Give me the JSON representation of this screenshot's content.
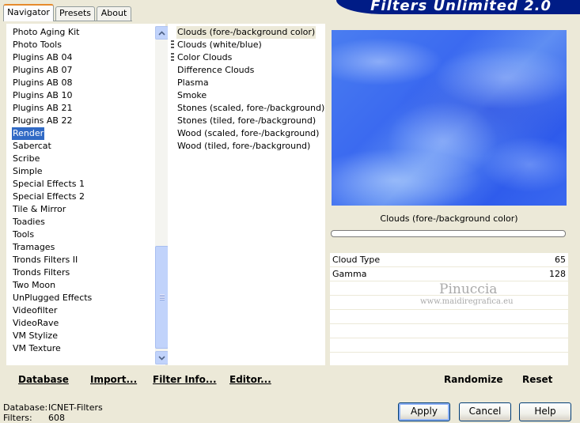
{
  "tabs": [
    {
      "label": "Navigator"
    },
    {
      "label": "Presets"
    },
    {
      "label": "About"
    }
  ],
  "banner_title": "Filters Unlimited 2.0",
  "categories": [
    "Photo Aging Kit",
    "Photo Tools",
    "Plugins AB 04",
    "Plugins AB 07",
    "Plugins AB 08",
    "Plugins AB 10",
    "Plugins AB 21",
    "Plugins AB 22",
    "Render",
    "Sabercat",
    "Scribe",
    "Simple",
    "Special Effects 1",
    "Special Effects 2",
    "Tile & Mirror",
    "Toadies",
    "Tools",
    "Tramages",
    "Tronds Filters II",
    "Tronds Filters",
    "Two Moon",
    "UnPlugged Effects",
    "Videofilter",
    "VideoRave",
    "VM Stylize",
    "VM Texture"
  ],
  "selected_category": "Render",
  "filters": [
    "Clouds (fore-/background color)",
    "Clouds (white/blue)",
    "Color Clouds",
    "Difference Clouds",
    "Plasma",
    "Smoke",
    "Stones (scaled, fore-/background)",
    "Stones (tiled, fore-/background)",
    "Wood (scaled, fore-/background)",
    "Wood (tiled, fore-/background)"
  ],
  "selected_filter": "Clouds (fore-/background color)",
  "preview": {
    "filter_name": "Clouds (fore-/background color)",
    "params": [
      {
        "label": "Cloud Type",
        "value": "65"
      },
      {
        "label": "Gamma",
        "value": "128"
      }
    ],
    "watermark": {
      "line1": "Pinuccia",
      "line2": "www.maidiregrafica.eu"
    }
  },
  "left_toolbar": {
    "database": "Database",
    "import": "Import...",
    "filter_info": "Filter Info...",
    "editor": "Editor..."
  },
  "right_toolbar": {
    "randomize": "Randomize",
    "reset": "Reset"
  },
  "status": {
    "database_label": "Database:",
    "database_value": "ICNET-Filters",
    "filters_label": "Filters:",
    "filters_value": "608"
  },
  "buttons": {
    "apply": "Apply",
    "cancel": "Cancel",
    "help": "Help"
  }
}
